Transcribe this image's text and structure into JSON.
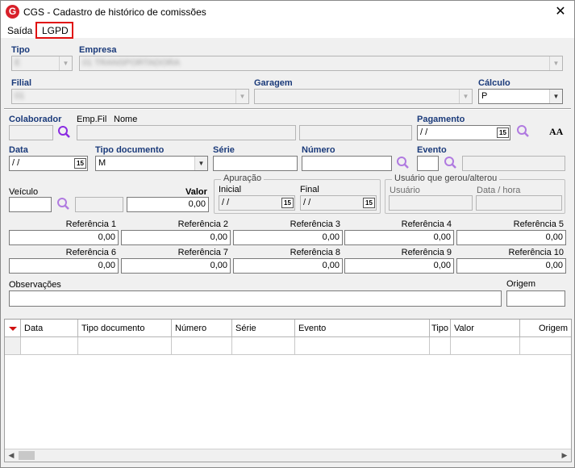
{
  "window": {
    "title": "CGS - Cadastro de histórico de comissões",
    "close_glyph": "✕",
    "logo_glyph": "G"
  },
  "menu": {
    "items": [
      "Saída",
      "LGPD"
    ]
  },
  "header": {
    "tipo_label": "Tipo",
    "tipo_value": "E",
    "empresa_label": "Empresa",
    "empresa_value": "01 TRANSPORTADORA",
    "filial_label": "Filial",
    "filial_value": "01",
    "garagem_label": "Garagem",
    "garagem_value": "",
    "calculo_label": "Cálculo",
    "calculo_value": "P"
  },
  "form": {
    "colaborador_label": "Colaborador",
    "empfil_label": "Emp.Fil",
    "nome_label": "Nome",
    "pagamento_label": "Pagamento",
    "pagamento_value": " / /",
    "data_label": "Data",
    "data_value": " / /",
    "tipo_doc_label": "Tipo documento",
    "tipo_doc_value": "M",
    "serie_label": "Série",
    "numero_label": "Número",
    "evento_label": "Evento",
    "veiculo_label": "Veículo",
    "valor_label": "Valor",
    "valor_value": "0,00",
    "apuracao_title": "Apuração",
    "inicial_label": "Inicial",
    "inicial_value": " / /",
    "final_label": "Final",
    "final_value": " / /",
    "usuario_group_title": "Usuário que gerou/alterou",
    "usuario_label": "Usuário",
    "datahora_label": "Data / hora",
    "observacoes_label": "Observações",
    "origem_label": "Origem",
    "font_icon_text": "AA",
    "calendar_glyph": "15",
    "references": [
      {
        "label": "Referência 1",
        "value": "0,00"
      },
      {
        "label": "Referência 2",
        "value": "0,00"
      },
      {
        "label": "Referência 3",
        "value": "0,00"
      },
      {
        "label": "Referência 4",
        "value": "0,00"
      },
      {
        "label": "Referência 5",
        "value": "0,00"
      },
      {
        "label": "Referência 6",
        "value": "0,00"
      },
      {
        "label": "Referência 7",
        "value": "0,00"
      },
      {
        "label": "Referência 8",
        "value": "0,00"
      },
      {
        "label": "Referência 9",
        "value": "0,00"
      },
      {
        "label": "Referência 10",
        "value": "0,00"
      }
    ]
  },
  "grid": {
    "columns": [
      "Data",
      "Tipo documento",
      "Número",
      "Série",
      "Evento",
      "Tipo",
      "Valor",
      "Origem"
    ]
  },
  "colors": {
    "accent_label": "#1a3a7a",
    "search_icon": "#8a2be2",
    "highlight_box": "#e01010",
    "logo": "#d8202a"
  }
}
